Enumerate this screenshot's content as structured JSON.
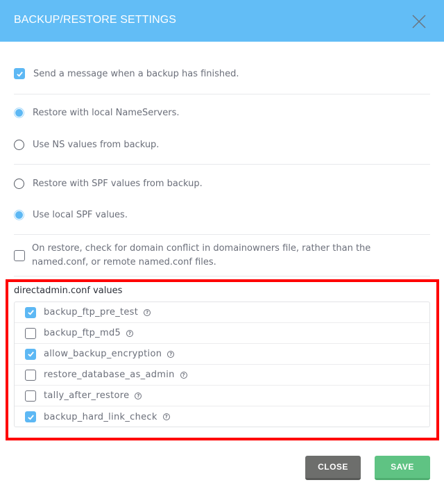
{
  "dialog": {
    "title": "BACKUP/RESTORE SETTINGS",
    "close_icon": "close-x-icon"
  },
  "options": {
    "send_message": {
      "label": "Send a message when a backup has finished.",
      "checked": true
    },
    "nameservers": [
      {
        "label": "Restore with local NameServers.",
        "selected": true
      },
      {
        "label": "Use NS values from backup.",
        "selected": false
      }
    ],
    "spf": [
      {
        "label": "Restore with SPF values from backup.",
        "selected": false
      },
      {
        "label": "Use local SPF values.",
        "selected": true
      }
    ],
    "domain_conflict": {
      "label_line1": "On restore, check for domain conflict in domainowners file, rather than the",
      "label_line2": "named.conf, or remote named.conf files.",
      "checked": false
    }
  },
  "conf": {
    "title": "directadmin.conf values",
    "help_icon": "?",
    "items": [
      {
        "name": "backup_ftp_pre_test",
        "checked": true
      },
      {
        "name": "backup_ftp_md5",
        "checked": false
      },
      {
        "name": "allow_backup_encryption",
        "checked": true
      },
      {
        "name": "restore_database_as_admin",
        "checked": false
      },
      {
        "name": "tally_after_restore",
        "checked": false
      },
      {
        "name": "backup_hard_link_check",
        "checked": true
      }
    ]
  },
  "footer": {
    "close_label": "CLOSE",
    "save_label": "SAVE"
  },
  "colors": {
    "header": "#62bdf6",
    "accent": "#5db8f4",
    "highlight_frame": "#ff0000",
    "close_button": "#6d6e6c",
    "save_button": "#5fc383"
  }
}
